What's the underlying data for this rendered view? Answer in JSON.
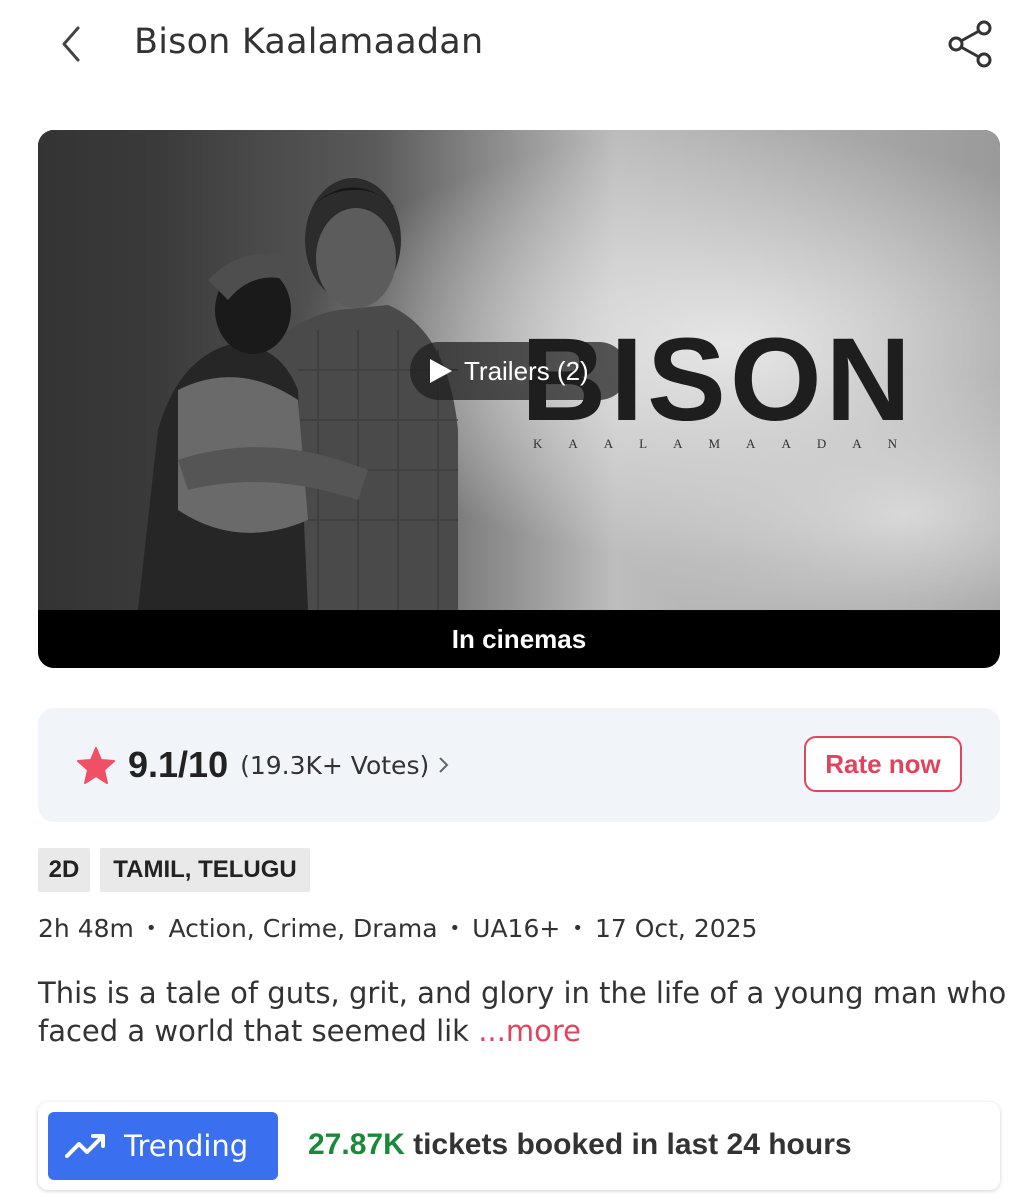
{
  "header": {
    "title": "Bison Kaalamaadan",
    "back_icon": "chevron-left-icon",
    "share_icon": "share-icon"
  },
  "banner": {
    "poster_logo_main": "BISON",
    "poster_logo_sub": "KAALAMAADAN",
    "trailer_label": "Trailers (2)",
    "status_label": "In cinemas"
  },
  "rating": {
    "value": "9.1/10",
    "votes": "(19.3K+ Votes)",
    "rate_label": "Rate now",
    "star_color": "#ef5066"
  },
  "tags": {
    "format": "2D",
    "languages": "TAMIL, TELUGU"
  },
  "meta": {
    "duration": "2h 48m",
    "genres": "Action, Crime, Drama",
    "certificate": "UA16+",
    "release_date": "17 Oct, 2025"
  },
  "description": {
    "text": "This is a tale of guts, grit, and glory in the life of a young man who faced a world that seemed lik",
    "more_label": "...more"
  },
  "trending": {
    "label": "Trending",
    "count": "27.87K",
    "suffix": "tickets booked in last 24 hours"
  },
  "colors": {
    "accent": "#e0455e",
    "trending_blue": "#3a6ff0",
    "trending_green": "#1a8a3a",
    "card_bg": "#f1f4f9"
  }
}
